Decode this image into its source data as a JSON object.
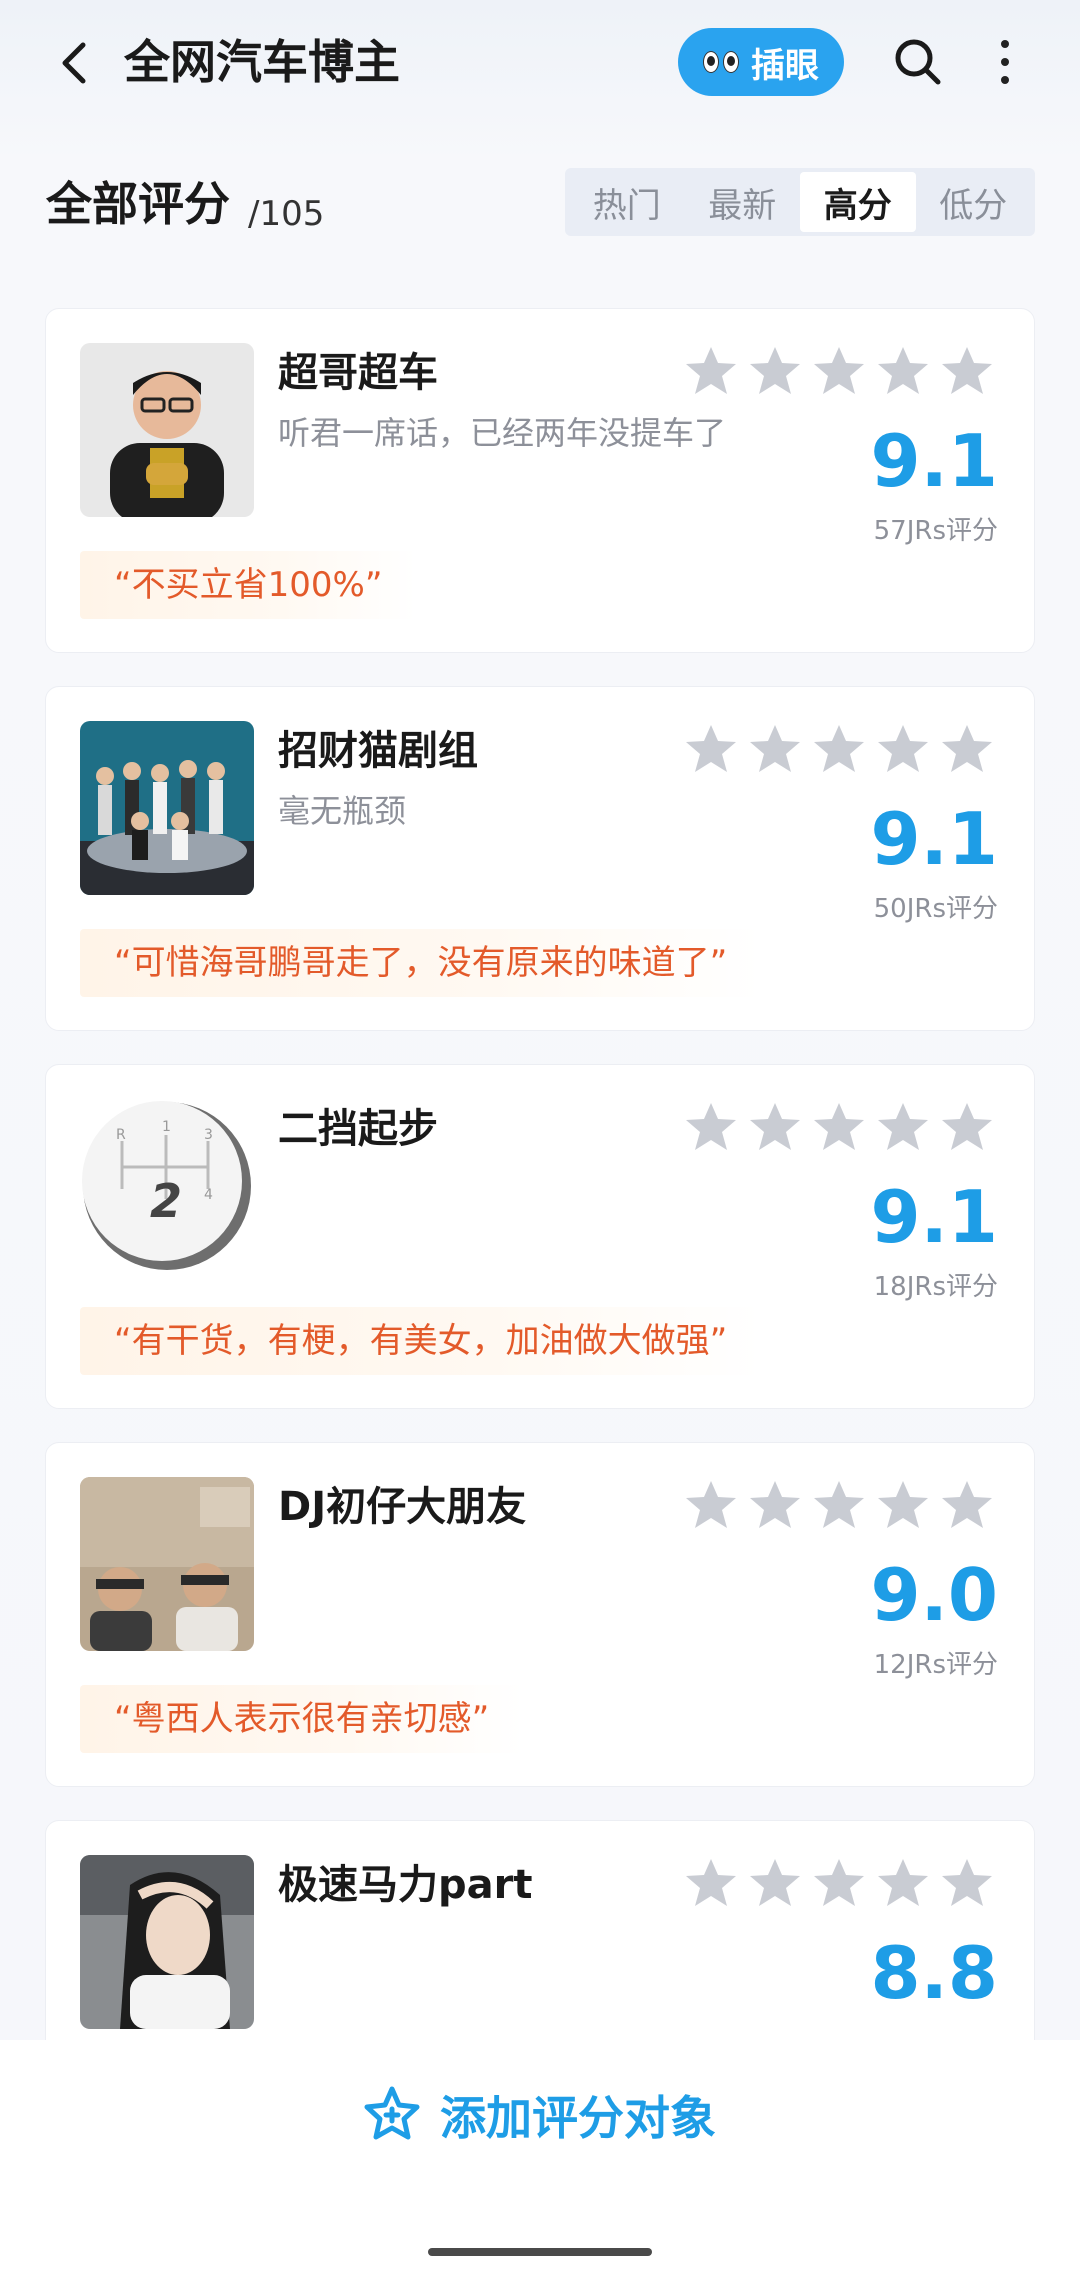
{
  "header": {
    "title": "全网汽车博主",
    "peek_label": "插眼"
  },
  "section": {
    "title": "全部评分",
    "count": "/105",
    "sort_tabs": [
      "热门",
      "最新",
      "高分",
      "低分"
    ],
    "active_sort": "高分"
  },
  "items": [
    {
      "name": "超哥超车",
      "tagline": "听君一席话，已经两年没提车了",
      "score": "9.1",
      "count": "57JRs评分",
      "quote": "“不买立省100%”",
      "stars_filled": 0
    },
    {
      "name": "招财猫剧组",
      "tagline": "毫无瓶颈",
      "score": "9.1",
      "count": "50JRs评分",
      "quote": "“可惜海哥鹏哥走了，没有原来的味道了”",
      "stars_filled": 0
    },
    {
      "name": "二挡起步",
      "tagline": "",
      "score": "9.1",
      "count": "18JRs评分",
      "quote": "“有干货，有梗，有美女，加油做大做强”",
      "stars_filled": 0
    },
    {
      "name": "DJ初仔大朋友",
      "tagline": "",
      "score": "9.0",
      "count": "12JRs评分",
      "quote": "“粤西人表示很有亲切感”",
      "stars_filled": 0
    },
    {
      "name": "极速马力part",
      "tagline": "",
      "score": "8.8",
      "count": "",
      "quote": "",
      "stars_filled": 0
    }
  ],
  "bottom": {
    "add_label": "添加评分对象"
  },
  "colors": {
    "accent": "#1e9de6",
    "quote_text": "#e35a2a",
    "star_gray": "#c9ccd3"
  }
}
